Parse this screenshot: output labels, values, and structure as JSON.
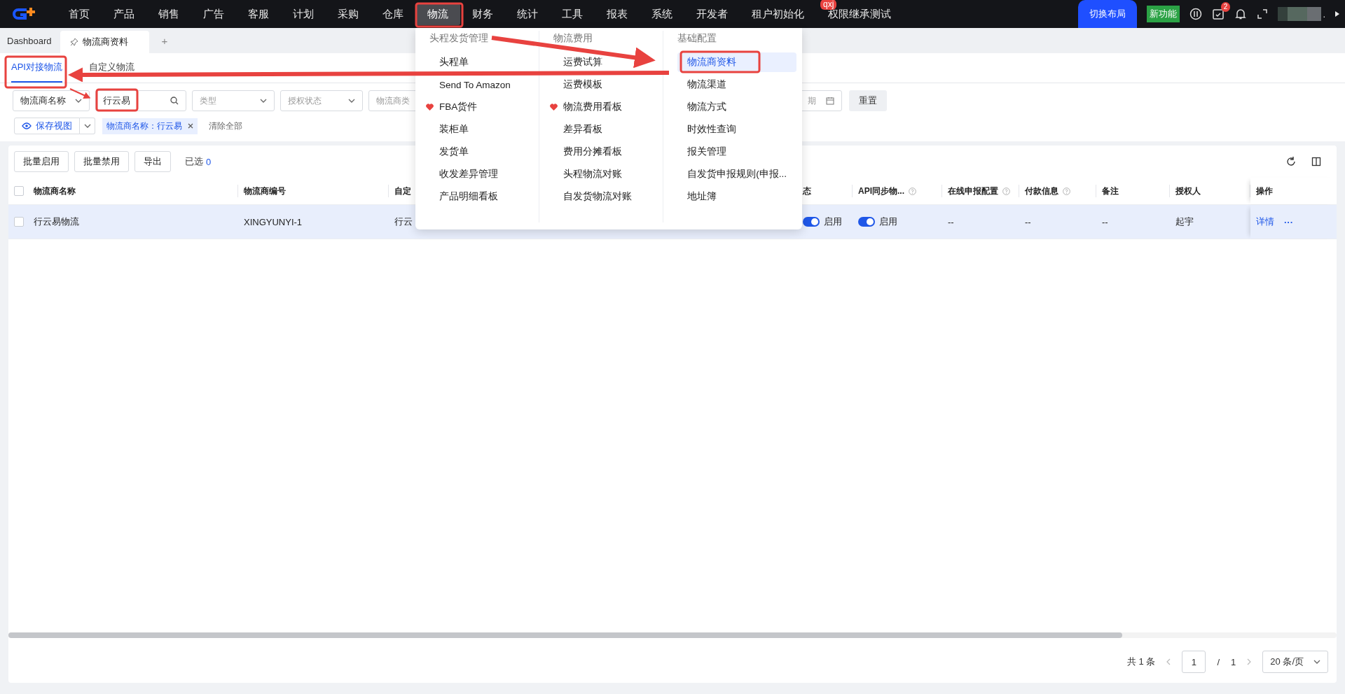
{
  "nav": {
    "items": [
      {
        "label": "首页",
        "selected": false
      },
      {
        "label": "产品",
        "selected": false
      },
      {
        "label": "销售",
        "selected": false
      },
      {
        "label": "广告",
        "selected": false
      },
      {
        "label": "客服",
        "selected": false
      },
      {
        "label": "计划",
        "selected": false
      },
      {
        "label": "采购",
        "selected": false
      },
      {
        "label": "仓库",
        "selected": false
      },
      {
        "label": "物流",
        "selected": true
      },
      {
        "label": "财务",
        "selected": false
      },
      {
        "label": "统计",
        "selected": false
      },
      {
        "label": "工具",
        "selected": false
      },
      {
        "label": "报表",
        "selected": false
      },
      {
        "label": "系统",
        "selected": false
      },
      {
        "label": "开发者",
        "selected": false
      },
      {
        "label": "租户初始化",
        "selected": false
      },
      {
        "label": "权限继承测试",
        "selected": false,
        "badge": "qxj"
      }
    ],
    "switch_layout": "切换布局",
    "new_feature": "新功能",
    "task_count": "2",
    "more": "."
  },
  "tab_bar": {
    "home": "Dashboard",
    "tabs": [
      {
        "label": "物流商资料",
        "selected": true
      }
    ],
    "add": "+"
  },
  "sub_tabs": [
    {
      "label": "API对接物流",
      "selected": true
    },
    {
      "label": "自定义物流",
      "selected": false
    }
  ],
  "filters": {
    "field_select": "物流商名称",
    "search_value": "行云易",
    "selects": [
      "类型",
      "授权状态",
      "物流商类"
    ],
    "date_placeholder": "期",
    "reset": "重置",
    "save_view": "保存视图",
    "tag": "物流商名称：行云易",
    "clear_all": "清除全部"
  },
  "toolbar": {
    "buttons": [
      "批量启用",
      "批量禁用",
      "导出"
    ],
    "selected_label": "已选",
    "selected_count": "0"
  },
  "table": {
    "all_checked": false,
    "columns": [
      {
        "label": "物流商名称",
        "help": false
      },
      {
        "label": "物流商编号",
        "help": false
      },
      {
        "label": "自定",
        "help": false
      },
      {
        "label": "态",
        "help": false
      },
      {
        "label": "API同步物...",
        "help": true
      },
      {
        "label": "在线申报配置",
        "help": true
      },
      {
        "label": "付款信息",
        "help": true
      },
      {
        "label": "备注",
        "help": false
      },
      {
        "label": "授权人",
        "help": false
      },
      {
        "label": "操作",
        "help": false
      }
    ],
    "rows": [
      {
        "checked": false,
        "highlighted": true,
        "cells": [
          {
            "kind": "text",
            "text": "行云易物流"
          },
          {
            "kind": "text",
            "text": "XINGYUNYI-1"
          },
          {
            "kind": "text",
            "text": "行云"
          },
          {
            "kind": "toggle",
            "on": true,
            "text": "启用"
          },
          {
            "kind": "toggle",
            "on": true,
            "text": "启用"
          },
          {
            "kind": "text",
            "text": "--"
          },
          {
            "kind": "text",
            "text": "--"
          },
          {
            "kind": "text",
            "text": "--"
          },
          {
            "kind": "text",
            "text": "起宇"
          },
          {
            "kind": "actions",
            "text": "详情",
            "more": "···"
          }
        ]
      }
    ]
  },
  "pagination": {
    "total": "共 1 条",
    "page": "1",
    "separator": "/",
    "pages": "1",
    "page_size": "20 条/页"
  },
  "menu": {
    "columns": [
      {
        "heading": "头程发货管理",
        "items": [
          {
            "label": "头程单",
            "favorite": false,
            "selected": false
          },
          {
            "label": "Send To Amazon",
            "favorite": false,
            "selected": false
          },
          {
            "label": "FBA货件",
            "favorite": true,
            "selected": false
          },
          {
            "label": "装柜单",
            "favorite": false,
            "selected": false
          },
          {
            "label": "发货单",
            "favorite": false,
            "selected": false
          },
          {
            "label": "收发差异管理",
            "favorite": false,
            "selected": false
          },
          {
            "label": "产品明细看板",
            "favorite": false,
            "selected": false
          }
        ]
      },
      {
        "heading": "物流费用",
        "items": [
          {
            "label": "运费试算",
            "favorite": false,
            "selected": false
          },
          {
            "label": "运费模板",
            "favorite": false,
            "selected": false
          },
          {
            "label": "物流费用看板",
            "favorite": true,
            "selected": false
          },
          {
            "label": "差异看板",
            "favorite": false,
            "selected": false
          },
          {
            "label": "费用分摊看板",
            "favorite": false,
            "selected": false
          },
          {
            "label": "头程物流对账",
            "favorite": false,
            "selected": false
          },
          {
            "label": "自发货物流对账",
            "favorite": false,
            "selected": false
          }
        ]
      },
      {
        "heading": "基础配置",
        "items": [
          {
            "label": "物流商资料",
            "favorite": false,
            "selected": true
          },
          {
            "label": "物流渠道",
            "favorite": false,
            "selected": false
          },
          {
            "label": "物流方式",
            "favorite": false,
            "selected": false
          },
          {
            "label": "时效性查询",
            "favorite": false,
            "selected": false
          },
          {
            "label": "报关管理",
            "favorite": false,
            "selected": false
          },
          {
            "label": "自发货申报规则(申报...",
            "favorite": false,
            "selected": false
          },
          {
            "label": "地址簿",
            "favorite": false,
            "selected": false
          }
        ]
      }
    ]
  }
}
